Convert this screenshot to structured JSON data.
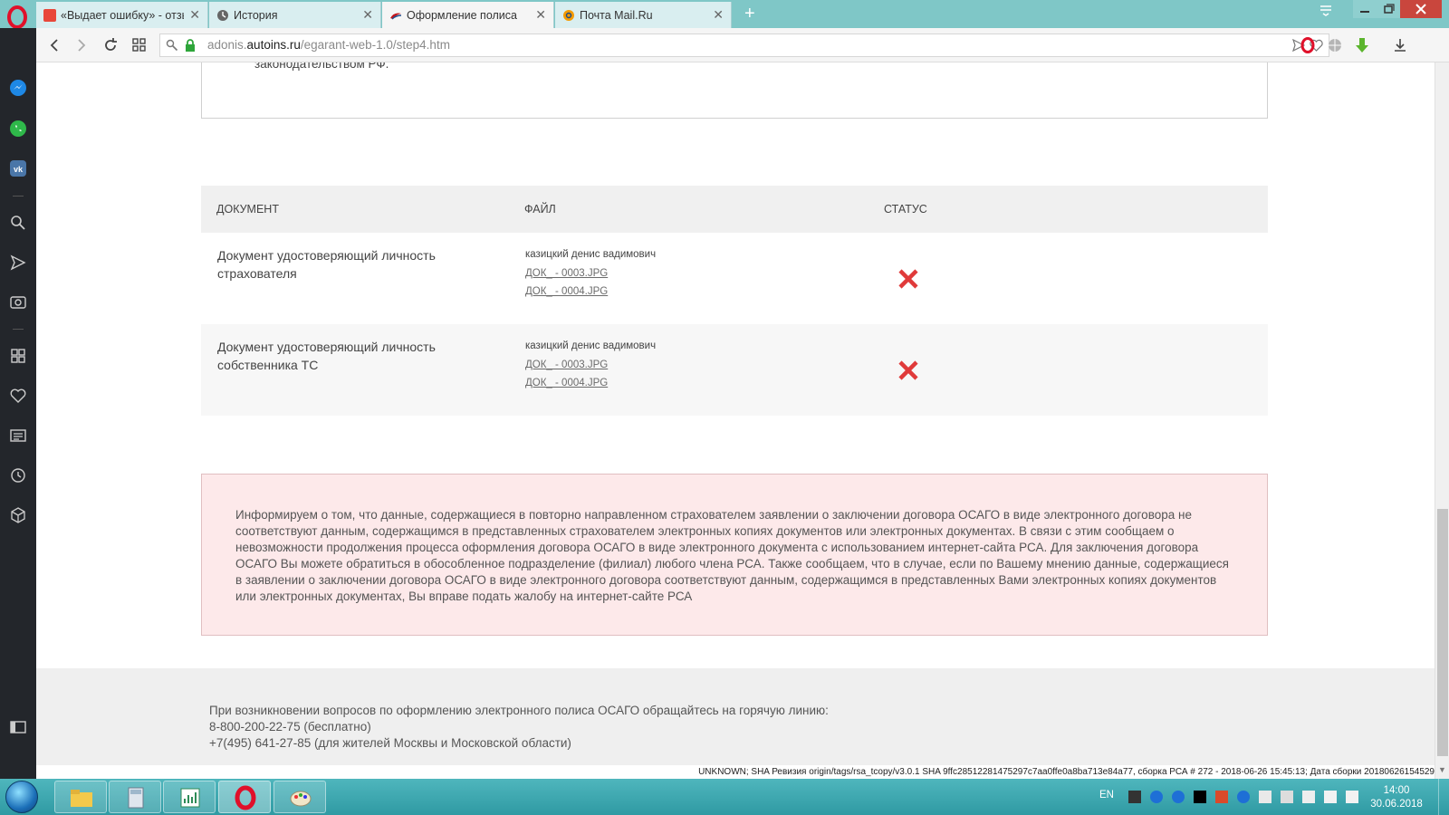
{
  "tabs": [
    {
      "title": "«Выдает ошибку» - отзыв",
      "icon": "irecommend-icon"
    },
    {
      "title": "История",
      "icon": "history-clock-icon"
    },
    {
      "title": "Оформление полиса",
      "icon": "autoins-logo-icon"
    },
    {
      "title": "Почта Mail.Ru",
      "icon": "mailru-icon"
    }
  ],
  "new_tab_label": "+",
  "address": {
    "domain_prefix": "adonis.",
    "domain": "autoins.ru",
    "path": "/egarant-web-1.0/step4.htm"
  },
  "content": {
    "top_text": "законодательством РФ.",
    "table": {
      "headers": {
        "document": "ДОКУМЕНТ",
        "file": "ФАЙЛ",
        "status": "СТАТУС"
      },
      "rows": [
        {
          "document": "Документ удостоверяющий личность страхователя",
          "owner": "казицкий денис вадимович",
          "files": [
            "ДОК_ - 0003.JPG",
            "ДОК_ - 0004.JPG"
          ],
          "status_icon": "red-cross-icon"
        },
        {
          "document": "Документ удостоверяющий личность собственника ТС",
          "owner": "казицкий денис вадимович",
          "files": [
            "ДОК_ - 0003.JPG",
            "ДОК_ - 0004.JPG"
          ],
          "status_icon": "red-cross-icon"
        }
      ]
    },
    "alert_text": "Информируем о том, что данные, содержащиеся в повторно направленном страхователем заявлении о заключении договора ОСАГО в виде электронного договора не соответствуют данным, содержащимся в представленных страхователем электронных копиях документов или электронных документах. В связи с этим сообщаем о невозможности продолжения процесса оформления договора ОСАГО в виде электронного документа с использованием интернет-сайта РСА. Для заключения договора ОСАГО Вы можете обратиться в обособленное подразделение (филиал) любого члена РСА. Также сообщаем, что в случае, если по Вашему мнению данные, содержащиеся в заявлении о заключении договора ОСАГО в виде электронного договора соответствуют данным, содержащимся в представленных Вами электронных копиях документов или электронных документах, Вы вправе подать жалобу на интернет-сайте РСА",
    "footer": {
      "line1": "При возникновении вопросов по оформлению электронного полиса ОСАГО обращайтесь на горячую линию:",
      "line2": "8-800-200-22-75 (бесплатно)",
      "line3": "+7(495) 641-27-85 (для жителей Москвы и Московской области)"
    },
    "build_info": "UNKNOWN; SHA Ревизия origin/tags/rsa_tcopy/v3.0.1 SHA 9ffc28512281475297c7aa0ffe0a8ba713e84a77, сборка РСА # 272 - 2018-06-26 15:45:13; Дата сборки 20180626154529"
  },
  "taskbar": {
    "language": "EN",
    "time": "14:00",
    "date": "30.06.2018"
  },
  "colors": {
    "tabbar": "#7fc7c7",
    "alert_bg": "#fde9ea",
    "status_error": "#e03a3a",
    "sidebar": "#23262b"
  }
}
